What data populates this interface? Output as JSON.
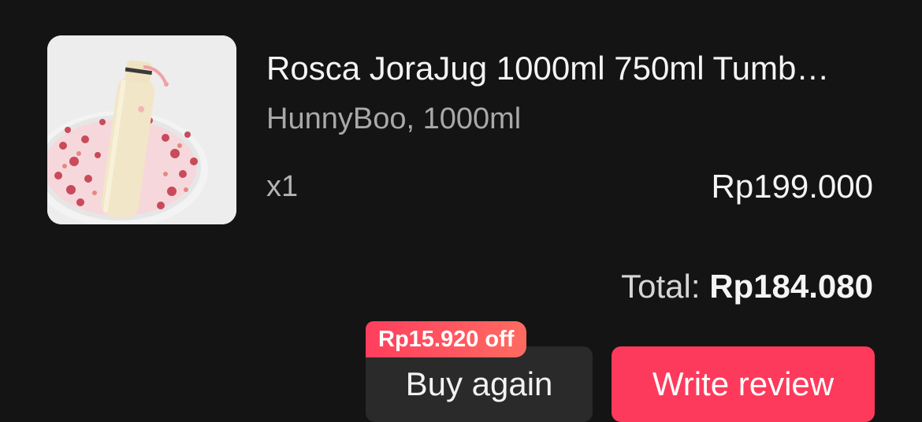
{
  "product": {
    "image_icon": "water-bottle-product-photo",
    "title": "Rosca JoraJug 1000ml 750ml Tumb…",
    "variant": "HunnyBoo, 1000ml",
    "quantity": "x1",
    "price": "Rp199.000"
  },
  "summary": {
    "total_label": "Total:",
    "total_value": "Rp184.080"
  },
  "actions": {
    "discount_badge": "Rp15.920 off",
    "buy_again_label": "Buy again",
    "write_review_label": "Write review"
  },
  "colors": {
    "background": "#141414",
    "primary_button": "#fe3a5c",
    "secondary_button": "#2a2a2a",
    "badge": "#ff4a5e"
  }
}
